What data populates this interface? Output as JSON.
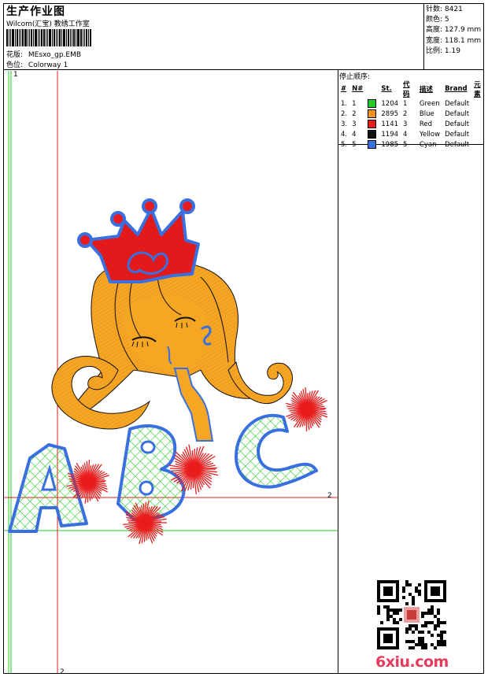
{
  "header": {
    "title": "生产作业图",
    "studio": "Wilcom(汇宝) 教绣工作室",
    "design_label": "花版:",
    "design_value": "MEsxo_gp.EMB",
    "colorway_label": "色位:",
    "colorway_value": "Colorway 1"
  },
  "stats": [
    {
      "label": "针数:",
      "value": "8421"
    },
    {
      "label": "颜色:",
      "value": "5"
    },
    {
      "label": "高度:",
      "value": "127.9 mm"
    },
    {
      "label": "宽度:",
      "value": "118.1 mm"
    },
    {
      "label": "比例:",
      "value": "1.19"
    }
  ],
  "stop_sequence": {
    "title": "停止顺序:",
    "headers": [
      "#",
      "N#",
      "St.",
      "代码",
      "描述",
      "Brand",
      "元素"
    ],
    "rows": [
      {
        "index": "1.",
        "n": "1",
        "color": "#22cc22",
        "st": "1204",
        "code": "1",
        "desc": "Green",
        "brand": "Default"
      },
      {
        "index": "2.",
        "n": "2",
        "color": "#f5921e",
        "st": "2895",
        "code": "2",
        "desc": "Blue",
        "brand": "Default"
      },
      {
        "index": "3.",
        "n": "3",
        "color": "#e81c1c",
        "st": "1141",
        "code": "3",
        "desc": "Red",
        "brand": "Default"
      },
      {
        "index": "4.",
        "n": "4",
        "color": "#111111",
        "st": "1194",
        "code": "4",
        "desc": "Yellow",
        "brand": "Default"
      },
      {
        "index": "5.",
        "n": "5",
        "color": "#3a6fe0",
        "st": "1985",
        "code": "5",
        "desc": "Cyan",
        "brand": "Default"
      }
    ]
  },
  "guides": {
    "green_label": "1",
    "red_label_right": "2",
    "red_label_bottom": "2"
  },
  "watermark": {
    "logo_text": "6xiu.com",
    "qr_icon": "qr-code-icon"
  },
  "colors": {
    "green": "#22cc22",
    "red": "#e81c1c",
    "orange": "#f5a623",
    "blue": "#3a6fe0",
    "black": "#111111"
  }
}
